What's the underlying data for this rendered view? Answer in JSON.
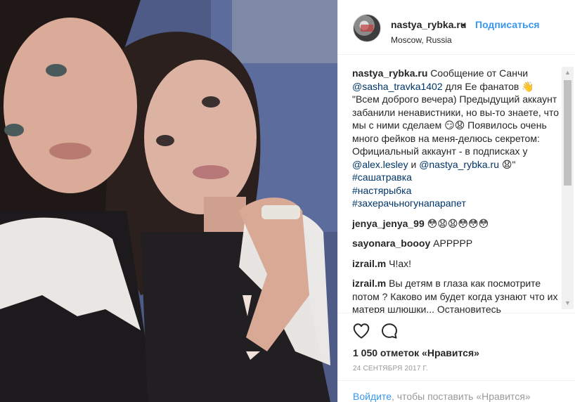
{
  "post": {
    "photo_icon": "selfie-photo",
    "author": {
      "username": "nastya_rybka.ru",
      "bullet": "•",
      "follow_label": "Подписаться",
      "location": "Moscow, Russia"
    },
    "caption": {
      "username": "nastya_rybka.ru",
      "line1_before": " Сообщение от Санчи ",
      "mention1": "@sasha_travka1402",
      "line1_after": " для Ее фанатов 👋",
      "body": "\"Всем доброго вечера) Предыдущий аккаунт забанили ненавистники, но вы-то знаете, что мы с ними сделаем 😏😧 Появилось очень много фейков на меня-делюсь секретом: Официальный аккаунт - в подписках у ",
      "mention2": "@alex.lesley",
      "and": " и ",
      "mention3": "@nastya_rybka.ru",
      "end": " 😧\"",
      "hashtags": [
        "#сашатравка",
        "#настярыбка",
        "#захерачьногунапарапет"
      ]
    },
    "comments": [
      {
        "username": "jenya_jenya_99",
        "text": " 😳😧😧😳😳😳"
      },
      {
        "username": "sayonara_boooy",
        "text": " АРРРРР"
      },
      {
        "username": "izrail.m",
        "text": " Ч!ах!"
      },
      {
        "username": "izrail.m",
        "text": " Вы детям в глаза как посмотрите потом ? Каково им будет когда узнают что их матеря шлюшки... Остановитесь"
      }
    ],
    "actions": {
      "like_icon": "heart-icon",
      "comment_icon": "comment-icon"
    },
    "likes_text": "1 050 отметок «Нравится»",
    "date": "24 СЕНТЯБРЯ 2017 Г.",
    "login": {
      "link": "Войдите",
      "rest": ", чтобы поставить «Нравится»"
    },
    "colors": {
      "accent": "#3897f0",
      "link": "#003569",
      "text": "#262626",
      "muted": "#999999"
    }
  }
}
